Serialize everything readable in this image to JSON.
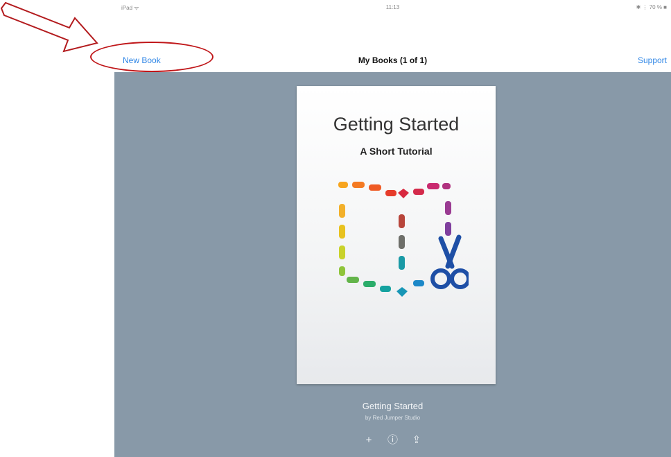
{
  "status_bar": {
    "carrier": "iPad ᯤ",
    "time": "11:13",
    "battery": "✱ ⋮ 70 % ■"
  },
  "nav": {
    "new_book": "New Book",
    "title": "My Books (1 of 1)",
    "support": "Support"
  },
  "book": {
    "title": "Getting Started",
    "subtitle": "A Short Tutorial",
    "caption_title": "Getting Started",
    "caption_author": "by Red Jumper Studio"
  },
  "actions": {
    "add": "+",
    "info": "ⓘ",
    "share": "⇪"
  },
  "icons": {
    "logo": "book-creator-logo-icon",
    "annotation_arrow": "red-arrow-icon"
  },
  "colors": {
    "accent": "#2f86e6",
    "background": "#8899a8",
    "annotation": "#c0171a"
  }
}
